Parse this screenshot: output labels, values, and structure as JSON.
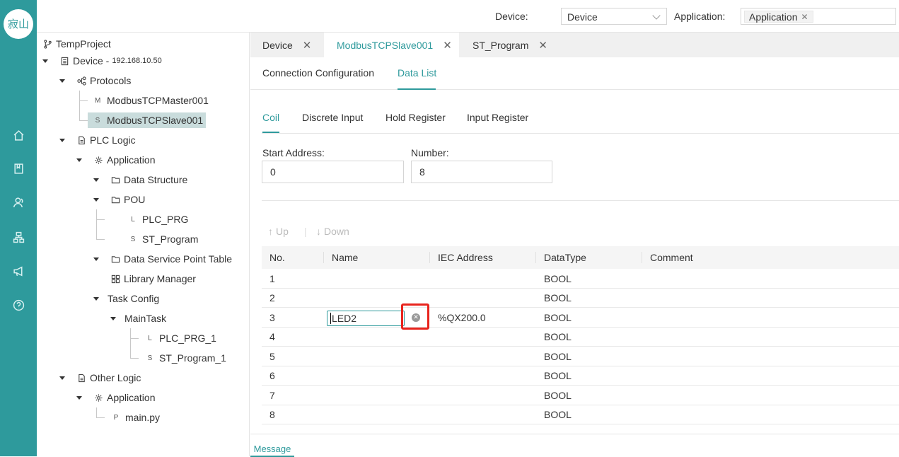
{
  "logo": {
    "text": "寂山"
  },
  "rail": {
    "icons": [
      "home-icon",
      "book-icon",
      "users-icon",
      "network-icon",
      "megaphone-icon",
      "help-icon"
    ]
  },
  "topbar": {
    "device_label": "Device:",
    "device_value": "Device",
    "application_label": "Application:",
    "application_tag": "Application"
  },
  "tree": {
    "project": "TempProject",
    "device": "Device -",
    "device_ip": "192.168.10.50",
    "protocols": "Protocols",
    "master": "ModbusTCPMaster001",
    "slave": "ModbusTCPSlave001",
    "plc_logic": "PLC Logic",
    "application": "Application",
    "data_structure": "Data Structure",
    "pou": "POU",
    "plc_prg": "PLC_PRG",
    "st_program": "ST_Program",
    "dsp_table": "Data Service Point Table",
    "library": "Library Manager",
    "task_config": "Task Config",
    "maintask": "MainTask",
    "plc_prg_1": "PLC_PRG_1",
    "st_program_1": "ST_Program_1",
    "other_logic": "Other Logic",
    "other_application": "Application",
    "main_py": "main.py",
    "letters": {
      "master": "M",
      "slave": "S",
      "plc_prg": "L",
      "st_program": "S",
      "plc_prg_1": "L",
      "st_program_1": "S",
      "main_py": "P"
    }
  },
  "tabs": [
    {
      "label": "Device"
    },
    {
      "label": "ModbusTCPSlave001"
    },
    {
      "label": "ST_Program"
    }
  ],
  "subtabs": {
    "connection": "Connection Configuration",
    "datalist": "Data List"
  },
  "regtabs": {
    "coil": "Coil",
    "discrete": "Discrete Input",
    "hold": "Hold Register",
    "input": "Input Register"
  },
  "form": {
    "start_label": "Start Address:",
    "start_value": "0",
    "number_label": "Number:",
    "number_value": "8"
  },
  "toolbar": {
    "up": "Up",
    "down": "Down"
  },
  "table": {
    "headers": {
      "no": "No.",
      "name": "Name",
      "iec": "IEC Address",
      "type": "DataType",
      "comment": "Comment"
    },
    "rows": [
      {
        "no": "1",
        "name": "",
        "iec": "",
        "type": "BOOL",
        "comment": ""
      },
      {
        "no": "2",
        "name": "",
        "iec": "",
        "type": "BOOL",
        "comment": ""
      },
      {
        "no": "3",
        "name": "LED2",
        "iec": "%QX200.0",
        "type": "BOOL",
        "comment": ""
      },
      {
        "no": "4",
        "name": "",
        "iec": "",
        "type": "BOOL",
        "comment": ""
      },
      {
        "no": "5",
        "name": "",
        "iec": "",
        "type": "BOOL",
        "comment": ""
      },
      {
        "no": "6",
        "name": "",
        "iec": "",
        "type": "BOOL",
        "comment": ""
      },
      {
        "no": "7",
        "name": "",
        "iec": "",
        "type": "BOOL",
        "comment": ""
      },
      {
        "no": "8",
        "name": "",
        "iec": "",
        "type": "BOOL",
        "comment": ""
      }
    ]
  },
  "bottom": {
    "message": "Message"
  },
  "colors": {
    "accent": "#2e9a9c",
    "highlight": "#e8241d",
    "selected": "#c9dcdc"
  }
}
